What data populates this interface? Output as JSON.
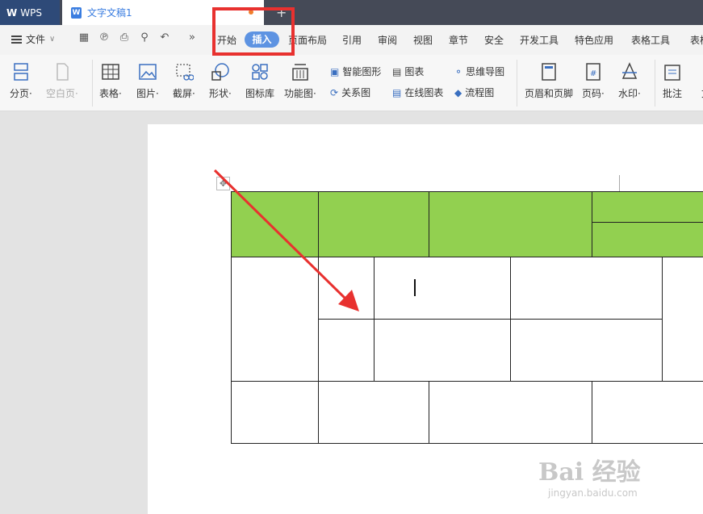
{
  "titlebar": {
    "wps_label": "WPS",
    "doc_title": "文字文稿1",
    "new_tab": "+"
  },
  "menu": {
    "file_label": "文件",
    "tabs": [
      "开始",
      "插入",
      "页面布局",
      "引用",
      "审阅",
      "视图",
      "章节",
      "安全",
      "开发工具",
      "特色应用",
      "表格工具",
      "表样"
    ],
    "active_tab": "插入"
  },
  "ribbon": {
    "page_break": "分页·",
    "blank_page": "空白页·",
    "table": "表格·",
    "picture": "图片·",
    "screenshot": "截屏·",
    "shape": "形状·",
    "icon_lib": "图标库",
    "function_chart": "功能图·",
    "smart_shape": "智能图形",
    "chart": "图表",
    "mind_map": "思维导图",
    "relation_chart": "关系图",
    "online_chart": "在线图表",
    "flowchart": "流程图",
    "header_footer": "页眉和页脚",
    "page_number": "页码·",
    "watermark": "水印·",
    "comment": "批注",
    "text_partial": "文"
  },
  "watermark": {
    "brand": "Bai 经验",
    "url": "jingyan.baidu.com"
  },
  "colors": {
    "accent": "#5d93e2",
    "highlight": "#e8312f",
    "table_header": "#92d050",
    "arrow": "#e8312f"
  }
}
